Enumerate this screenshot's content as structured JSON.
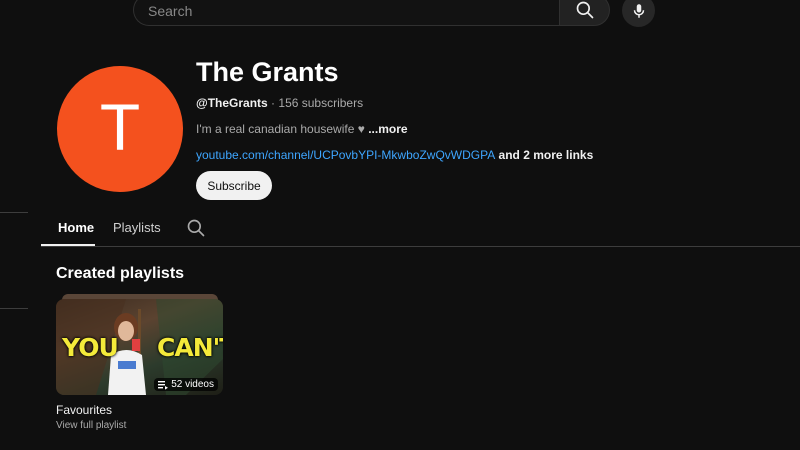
{
  "header": {
    "search_placeholder": "Search"
  },
  "channel": {
    "avatar_letter": "T",
    "avatar_color": "#f4511e",
    "name": "The Grants",
    "handle": "@TheGrants",
    "separator": " · ",
    "subscribers": "156 subscribers",
    "description": "I'm a real canadian housewife ♥ ",
    "more_label": "...more",
    "link": "youtube.com/channel/UCPovbYPI-MkwboZwQvWDGPA",
    "more_links": " and 2 more links",
    "subscribe_label": "Subscribe"
  },
  "tabs": [
    {
      "label": "Home",
      "active": true
    },
    {
      "label": "Playlists",
      "active": false
    }
  ],
  "section": {
    "title": "Created playlists"
  },
  "playlists": [
    {
      "thumbnail_text_left": "YOU",
      "thumbnail_text_right": "CAN'T",
      "video_count": "52 videos",
      "title": "Favourites",
      "link_label": "View full playlist"
    }
  ],
  "colors": {
    "background": "#0f0f0f",
    "link": "#3ea6ff"
  }
}
